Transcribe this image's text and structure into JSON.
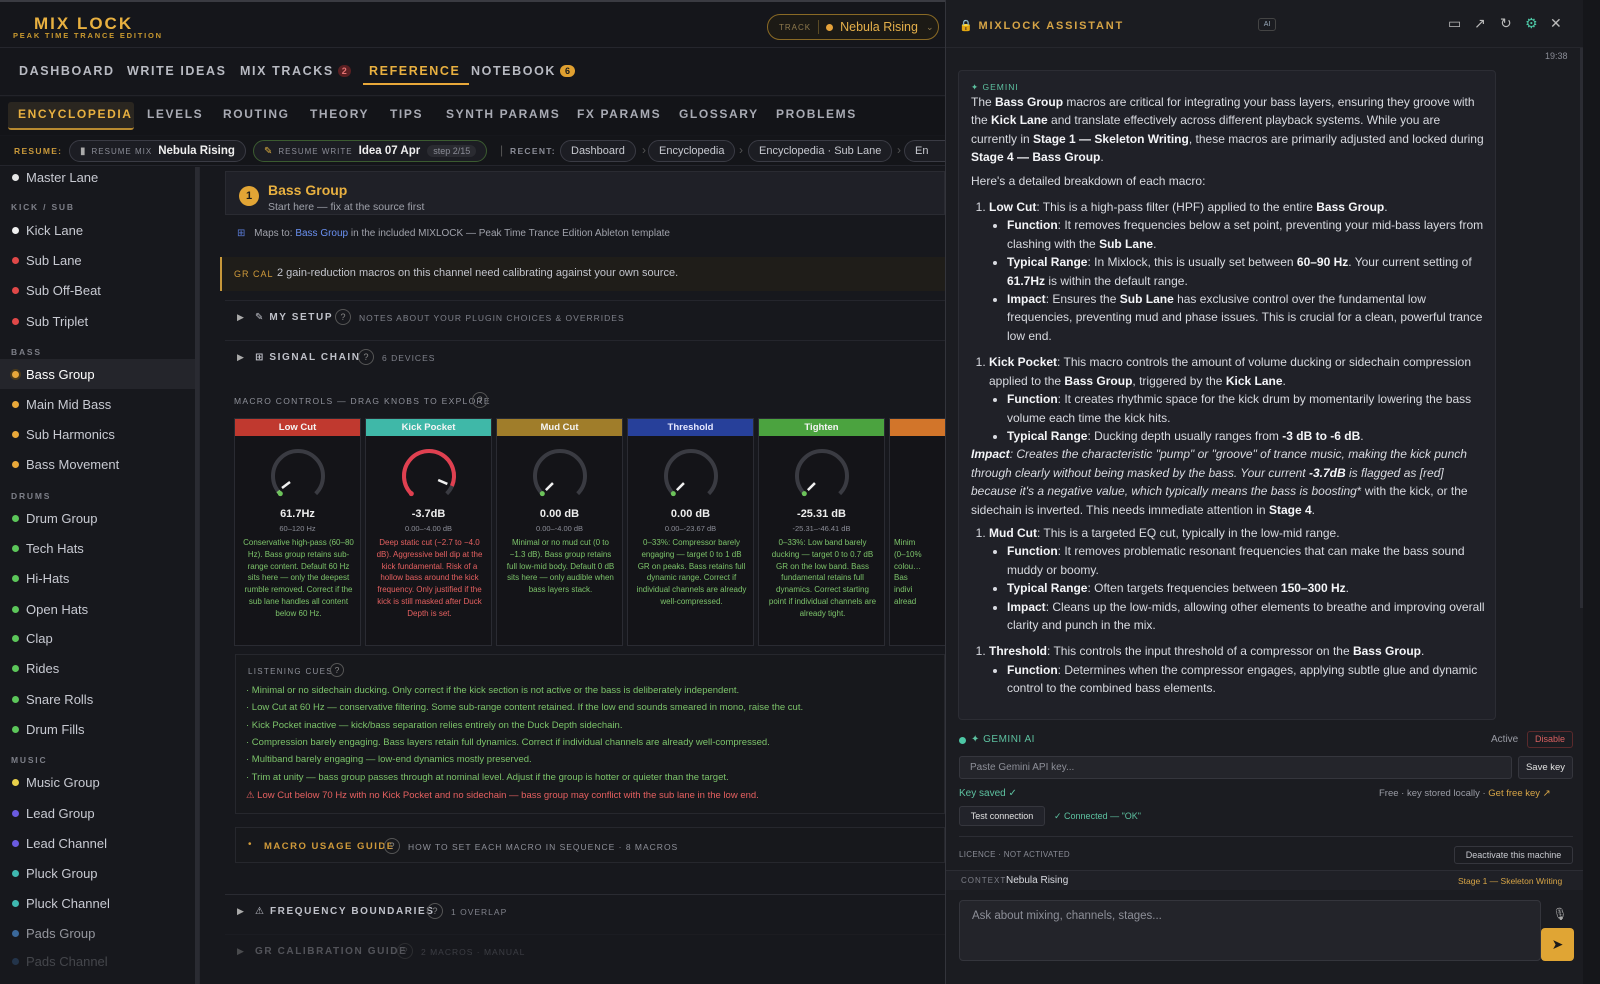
{
  "header": {
    "logo": "MIX LOCK",
    "logo_sub": "PEAK TIME TRANCE EDITION",
    "track_label": "TRACK",
    "track_name": "Nebula Rising"
  },
  "main_nav": [
    {
      "label": "DASHBOARD"
    },
    {
      "label": "WRITE IDEAS"
    },
    {
      "label": "MIX TRACKS",
      "badge": "2"
    },
    {
      "label": "REFERENCE",
      "active": true
    },
    {
      "label": "NOTEBOOK",
      "badge": "6"
    }
  ],
  "sub_nav": [
    "ENCYCLOPEDIA",
    "LEVELS",
    "ROUTING",
    "THEORY",
    "TIPS",
    "SYNTH PARAMS",
    "FX PARAMS",
    "GLOSSARY",
    "PROBLEMS"
  ],
  "resume": {
    "label": "RESUME:",
    "mix_tag": "RESUME MIX",
    "mix_val": "Nebula Rising",
    "write_tag": "RESUME WRITE",
    "write_val": "Idea 07 Apr",
    "write_step": "step 2/15",
    "recent_label": "RECENT:",
    "recent": [
      "Dashboard",
      "Encyclopedia",
      "Encyclopedia · Sub Lane",
      "En"
    ]
  },
  "sidebar": {
    "top_item": "Master Lane",
    "kick_head": "KICK / SUB",
    "kick": [
      "Kick Lane",
      "Sub Lane",
      "Sub Off-Beat",
      "Sub Triplet"
    ],
    "bass_head": "BASS",
    "bass": [
      "Bass Group",
      "Main Mid Bass",
      "Sub Harmonics",
      "Bass Movement"
    ],
    "drums_head": "DRUMS",
    "drums": [
      "Drum Group",
      "Tech Hats",
      "Hi-Hats",
      "Open Hats",
      "Clap",
      "Rides",
      "Snare Rolls",
      "Drum Fills"
    ],
    "music_head": "MUSIC",
    "music": [
      "Music Group",
      "Lead Group",
      "Lead Channel",
      "Pluck Group",
      "Pluck Channel",
      "Pads Group",
      "Pads Channel"
    ]
  },
  "content": {
    "num": "1",
    "title": "Bass Group",
    "subtitle": "Start here — fix at the source first",
    "maps_pre": "Maps to:",
    "maps_link": "Bass Group",
    "maps_post": "in the included MIXLOCK — Peak Time Trance Edition Ableton template",
    "grcal_tag": "GR CAL",
    "grcal_text": "2 gain-reduction macros on this channel need calibrating against your own source.",
    "my_setup": "✎ MY SETUP",
    "my_setup_note": "NOTES ABOUT YOUR PLUGIN CHOICES & OVERRIDES",
    "signal_chain": "⊞ SIGNAL CHAIN",
    "signal_chain_note": "6 DEVICES",
    "macro_head": "MACRO CONTROLS — DRAG KNOBS TO EXPLORE",
    "macros": [
      {
        "name": "Low Cut",
        "color": "#c0392f",
        "value": "61.7Hz",
        "range": "60–120 Hz",
        "level": 0.03,
        "text_color": "#7cc36a",
        "desc": "Conservative high-pass (60–80 Hz). Bass group retains sub-range content. Default 60 Hz sits here — only the deepest rumble removed. Correct if the sub lane handles all content below 60 Hz."
      },
      {
        "name": "Kick Pocket",
        "color": "#3fb8a8",
        "value": "-3.7dB",
        "range": "0.00–-4.00 dB",
        "level": 0.92,
        "text_color": "#e56060",
        "arc": "#e04050",
        "desc": "Deep static cut (−2.7 to −4.0 dB). Aggressive bell dip at the kick fundamental. Risk of a hollow bass around the kick frequency. Only justified if the kick is still masked after Duck Depth is set."
      },
      {
        "name": "Mud Cut",
        "color": "#a07d2a",
        "value": "0.00 dB",
        "range": "0.00–-4.00 dB",
        "level": 0.0,
        "text_color": "#7cc36a",
        "desc": "Minimal or no mud cut (0 to −1.3 dB). Bass group retains full low-mid body. Default 0 dB sits here — only audible when bass layers stack."
      },
      {
        "name": "Threshold",
        "color": "#27409a",
        "value": "0.00 dB",
        "range": "0.00–-23.67 dB",
        "level": 0.0,
        "text_color": "#7cc36a",
        "desc": "0–33%: Compressor barely engaging — target 0 to 1 dB GR on peaks. Bass retains full dynamic range. Correct if individual channels are already well-compressed."
      },
      {
        "name": "Tighten",
        "color": "#4ba33f",
        "value": "-25.31 dB",
        "range": "-25.31–-46.41 dB",
        "level": 0.0,
        "text_color": "#7cc36a",
        "desc": "0–33%: Low band barely ducking — target 0 to 0.7 dB GR on the low band. Bass fundamental retains full dynamics. Correct starting point if individual channels are already tight."
      },
      {
        "name": "",
        "color": "#d2752a",
        "value": "",
        "range": "",
        "level": 0.0,
        "text_color": "#7cc36a",
        "desc": "Minim (0–10% colou… Bas indivi alread"
      }
    ],
    "cues_head": "LISTENING CUES",
    "cues": [
      "· Minimal or no sidechain ducking. Only correct if the kick section is not active or the bass is deliberately independent.",
      "· Low Cut at 60 Hz — conservative filtering. Some sub-range content retained. If the low end sounds smeared in mono, raise the cut.",
      "· Kick Pocket inactive — kick/bass separation relies entirely on the Duck Depth sidechain.",
      "· Compression barely engaging. Bass layers retain full dynamics. Correct if individual channels are already well-compressed.",
      "· Multiband barely engaging — low-end dynamics mostly preserved.",
      "· Trim at unity — bass group passes through at nominal level. Adjust if the group is hotter or quieter than the target.",
      "⚠ Low Cut below 70 Hz with no Kick Pocket and no sidechain — bass group may conflict with the sub lane in the low end."
    ],
    "usage_title": "MACRO USAGE GUIDE",
    "usage_note": "HOW TO SET EACH MACRO IN SEQUENCE · 8 MACROS",
    "freq_title": "⚠ FREQUENCY BOUNDARIES",
    "freq_note": "1 OVERLAP",
    "grguide_title": "GR CALIBRATION GUIDE",
    "grguide_note": "2 MACROS · MANUAL"
  },
  "assistant": {
    "title": "MIXLOCK ASSISTANT",
    "ai_badge": "AI",
    "time": "19:38",
    "from": "✦ GEMINI",
    "ai_label": "✦ GEMINI AI",
    "active": "Active",
    "disable": "Disable",
    "api_placeholder": "Paste Gemini API key...",
    "save_key": "Save key",
    "key_saved": "Key saved ✓",
    "free_text": "Free · key stored locally ·",
    "free_link": "Get free key ↗",
    "test_conn": "Test connection",
    "connected": "✓ Connected — \"OK\"",
    "licence": "LICENCE · NOT ACTIVATED",
    "deactivate": "Deactivate this machine",
    "context_label": "CONTEXT",
    "context_val": "Nebula Rising",
    "context_stage": "Stage 1 — Skeleton Writing",
    "ask_placeholder": "Ask about mixing, channels, stages..."
  }
}
